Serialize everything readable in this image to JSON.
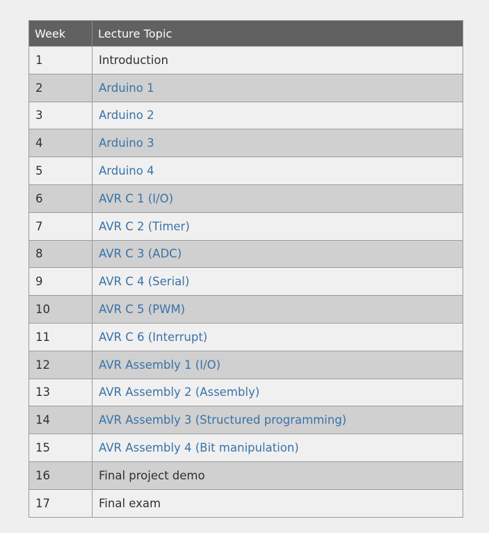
{
  "table": {
    "headers": {
      "week": "Week",
      "topic": "Lecture Topic"
    },
    "rows": [
      {
        "week": "1",
        "topic": "Introduction",
        "link": false
      },
      {
        "week": "2",
        "topic": "Arduino 1",
        "link": true
      },
      {
        "week": "3",
        "topic": "Arduino 2",
        "link": true
      },
      {
        "week": "4",
        "topic": "Arduino 3",
        "link": true
      },
      {
        "week": "5",
        "topic": "Arduino 4",
        "link": true
      },
      {
        "week": "6",
        "topic": "AVR C 1 (I/O)",
        "link": true
      },
      {
        "week": "7",
        "topic": "AVR C 2 (Timer)",
        "link": true
      },
      {
        "week": "8",
        "topic": "AVR C 3 (ADC)",
        "link": true
      },
      {
        "week": "9",
        "topic": "AVR C 4 (Serial)",
        "link": true
      },
      {
        "week": "10",
        "topic": "AVR C 5 (PWM)",
        "link": true
      },
      {
        "week": "11",
        "topic": "AVR C 6 (Interrupt)",
        "link": true
      },
      {
        "week": "12",
        "topic": "AVR Assembly 1 (I/O)",
        "link": true
      },
      {
        "week": "13",
        "topic": "AVR Assembly 2 (Assembly)",
        "link": true
      },
      {
        "week": "14",
        "topic": "AVR Assembly 3 (Structured programming)",
        "link": true
      },
      {
        "week": "15",
        "topic": "AVR Assembly 4 (Bit manipulation)",
        "link": true
      },
      {
        "week": "16",
        "topic": "Final project demo",
        "link": false
      },
      {
        "week": "17",
        "topic": "Final exam",
        "link": false
      }
    ]
  },
  "colors": {
    "page_background": "#efefef",
    "header_background": "#616161",
    "header_text": "#ffffff",
    "row_light": "#f0f0f0",
    "row_dark": "#d0d0d0",
    "link": "#3a72a8",
    "text": "#2f2f2f",
    "border": "#9a9a9a"
  }
}
